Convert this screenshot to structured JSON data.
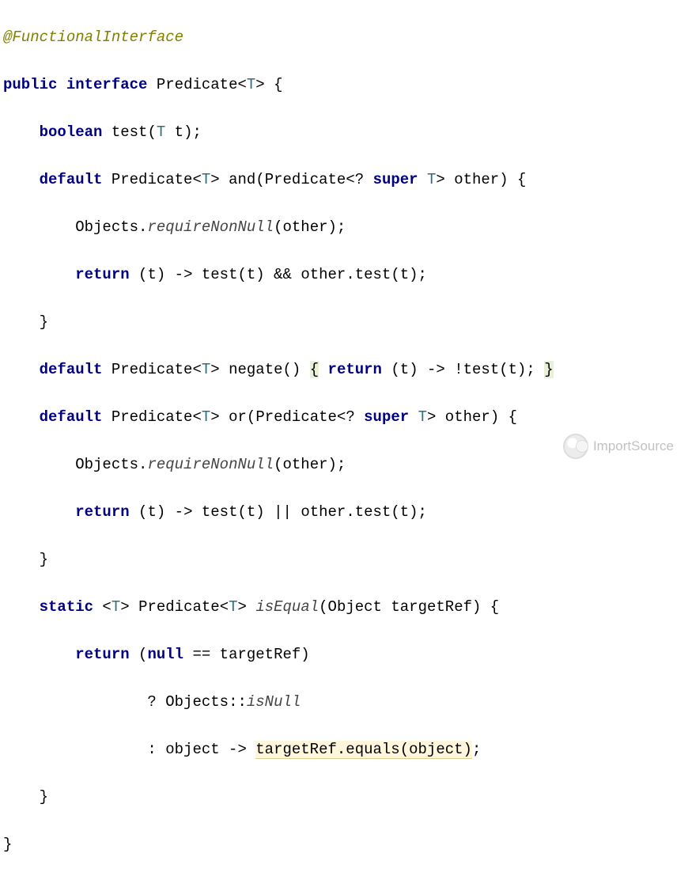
{
  "code": {
    "annotation": "@FunctionalInterface",
    "line2_public": "public",
    "line2_interface": "interface",
    "line2_class": "Predicate",
    "line2_T": "T",
    "line3_type": "boolean",
    "line3_method": "test",
    "line3_param": "T",
    "line3_name": "t",
    "line4_default": "default",
    "line4_class": "Predicate",
    "line4_T": "T",
    "line4_method": "and",
    "line4_ptype": "Predicate",
    "line4_wild": "?",
    "line4_super": "super",
    "line4_T2": "T",
    "line4_other": "other",
    "line5_objects": "Objects",
    "line5_req": "requireNonNull",
    "line5_arg": "other",
    "line6_return": "return",
    "line6_t": "t",
    "line6_test": "test",
    "line6_and_sym": "&&",
    "line6_other": "other",
    "line6_t2": "t",
    "line8_default": "default",
    "line8_class": "Predicate",
    "line8_T": "T",
    "line8_method": "negate",
    "line8_return": "return",
    "line8_t": "t",
    "line8_test": "test",
    "line8_t2": "t",
    "line9_default": "default",
    "line9_class": "Predicate",
    "line9_T": "T",
    "line9_method": "or",
    "line9_ptype": "Predicate",
    "line9_wild": "?",
    "line9_super": "super",
    "line9_T2": "T",
    "line9_other": "other",
    "line10_objects": "Objects",
    "line10_req": "requireNonNull",
    "line10_arg": "other",
    "line11_return": "return",
    "line11_t": "t",
    "line11_test": "test",
    "line11_or_sym": "||",
    "line11_other": "other",
    "line11_t2": "t",
    "line13_static": "static",
    "line13_Tp": "T",
    "line13_class": "Predicate",
    "line13_T": "T",
    "line13_method": "isEqual",
    "line13_ptype": "Object",
    "line13_pname": "targetRef",
    "line14_return": "return",
    "line14_null": "null",
    "line14_target": "targetRef",
    "line15_objects": "Objects",
    "line15_isnull": "isNull",
    "line16_object": "object",
    "line16_target": "targetRef",
    "line16_equals": "equals",
    "line16_obj": "object"
  },
  "watermark": {
    "text": "ImportSource"
  }
}
